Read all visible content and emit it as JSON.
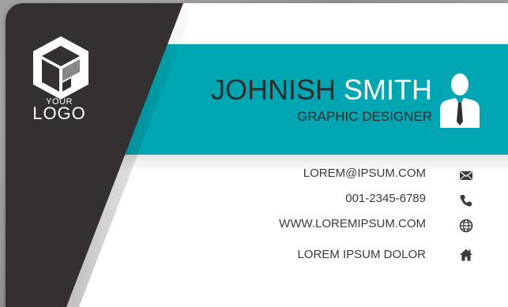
{
  "logo": {
    "line1": "YOUR",
    "line2": "LOGO"
  },
  "person": {
    "first_name": "JOHNISH",
    "last_name": "SMITH",
    "title": "GRAPHIC DESIGNER"
  },
  "contacts": [
    {
      "text": "LOREM@IPSUM.COM",
      "icon": "envelope-icon"
    },
    {
      "text": "001-2345-6789",
      "icon": "phone-icon"
    },
    {
      "text": "WWW.LOREMIPSUM.COM",
      "icon": "globe-icon"
    },
    {
      "text": "LOREM IPSUM DOLOR",
      "icon": "home-icon"
    }
  ],
  "colors": {
    "accent": "#00a7b3",
    "dark": "#2f2c2c",
    "card": "#ffffff",
    "background": "#9a9a98"
  }
}
